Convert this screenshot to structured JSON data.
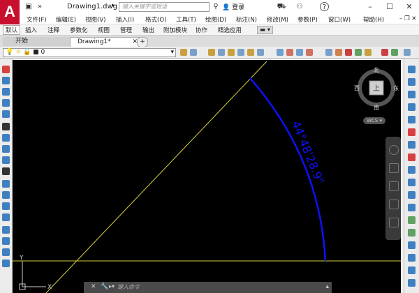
{
  "app": {
    "logo_letter": "A",
    "doc_title": "Drawing1.dwg",
    "search_placeholder": "键入关键字或短语",
    "login_label": "登录"
  },
  "menu": [
    "文件(F)",
    "编辑(E)",
    "视图(V)",
    "插入(I)",
    "格式(O)",
    "工具(T)",
    "绘图(D)",
    "标注(N)",
    "修改(M)",
    "参数(P)",
    "窗口(W)",
    "帮助(H)"
  ],
  "ribbon_tabs": [
    "默认",
    "插入",
    "注释",
    "参数化",
    "视图",
    "管理",
    "输出",
    "附加模块",
    "协作",
    "精选应用"
  ],
  "file_tabs": {
    "start": "开始",
    "drawing": "Drawing1*"
  },
  "layer": {
    "current": "0"
  },
  "viewcube": {
    "north": "北",
    "south": "南",
    "east": "东",
    "west": "西",
    "top": "上",
    "wcs": "WCS"
  },
  "drawing": {
    "dimension_text": "44°48'28.9\"",
    "axis_y": "Y",
    "axis_x": "X"
  },
  "command": {
    "placeholder": "键入命令"
  },
  "colors": {
    "dimension": "#1010ff",
    "line": "#d8d040",
    "background": "#000000",
    "logo": "#c8102e"
  }
}
